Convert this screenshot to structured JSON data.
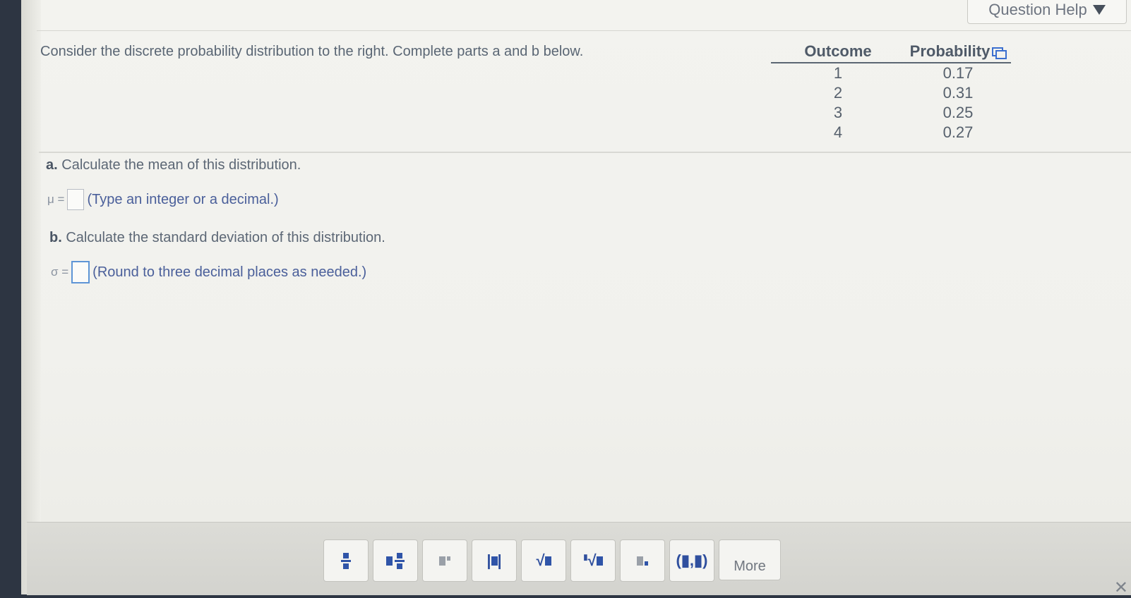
{
  "header": {
    "help_label": "Question Help"
  },
  "question": {
    "intro": "Consider the discrete probability distribution to the right. Complete parts a and b below.",
    "table": {
      "headers": [
        "Outcome",
        "Probability"
      ],
      "rows": [
        {
          "outcome": "1",
          "probability": "0.17"
        },
        {
          "outcome": "2",
          "probability": "0.31"
        },
        {
          "outcome": "3",
          "probability": "0.25"
        },
        {
          "outcome": "4",
          "probability": "0.27"
        }
      ]
    },
    "part_a": {
      "letter": "a.",
      "text": "Calculate the mean of this distribution.",
      "symbol": "μ =",
      "value": "",
      "hint": "(Type an integer or a decimal.)"
    },
    "part_b": {
      "letter": "b.",
      "text": "Calculate the standard deviation of this distribution.",
      "symbol": "σ =",
      "value": "",
      "hint": "(Round to three decimal places as needed.)"
    }
  },
  "toolbar": {
    "tools": [
      "fraction-icon",
      "mixed-number-icon",
      "exponent-icon",
      "absolute-value-icon",
      "square-root-icon",
      "nth-root-icon",
      "subscript-icon",
      "ordered-pair-icon"
    ],
    "more_label": "More",
    "ordered_pair_label": "(▮,▮)"
  },
  "colors": {
    "accent": "#2f54a8",
    "hint": "#4a5f9a",
    "active_box": "#5e95d6"
  }
}
